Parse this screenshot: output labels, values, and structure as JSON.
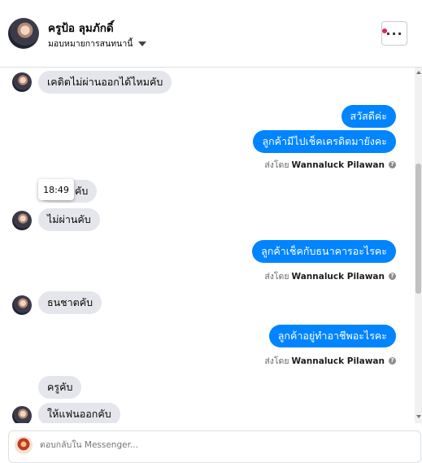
{
  "header": {
    "name": "ครูป้อ ลุมภักดิ์",
    "assign_label": "มอบหมายการสนทนานี้",
    "more_label": "···"
  },
  "tooltip": "18:49",
  "messages": [
    {
      "from": "them",
      "text": "เคดิตไม่ผ่านออกได้ไหมคับ"
    },
    {
      "from": "me",
      "text": "สวัสดีค่ะ"
    },
    {
      "from": "me",
      "text": "ลูกค้ามีไปเช็คเครดิตมายังคะ"
    },
    {
      "from": "them",
      "text": "วคับ"
    },
    {
      "from": "them",
      "text": "ไม่ผ่านคับ"
    },
    {
      "from": "me",
      "text": "ลูกค้าเช็คกับธนาคารอะไรคะ"
    },
    {
      "from": "them",
      "text": "ธนชาตคับ"
    },
    {
      "from": "me",
      "text": "ลูกค้าอยู่ทำอาชีพอะไรคะ"
    },
    {
      "from": "them",
      "text": "ครูคับ"
    },
    {
      "from": "them",
      "text": "ให้แฟนออกคับ"
    }
  ],
  "sent_by": {
    "prefix": "ส่งโดย",
    "name": "Wannaluck Pilawan",
    "help": "?"
  },
  "composer": {
    "placeholder": "ตอบกลับใน Messenger..."
  },
  "colors": {
    "outgoing": "#0084ff",
    "incoming": "#e4e6eb"
  }
}
